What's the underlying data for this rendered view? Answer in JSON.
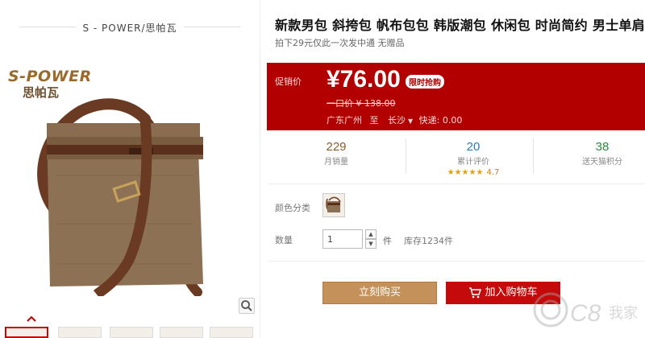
{
  "left": {
    "brand_title": "S - POWER/思帕瓦",
    "logo_en": "S-POWER",
    "logo_cn": "思帕瓦",
    "zoom_icon": "magnifier-icon",
    "thumb_up_icon": "chevron-up-icon",
    "thumbnail_count": 5
  },
  "product": {
    "title": "新款男包 斜挎包 帆布包包 韩版潮包 休闲包 时尚简约 男士单肩包",
    "subtitle": "拍下29元仅此一次发中通 无赠品"
  },
  "price": {
    "promo_label": "促销价",
    "current": "¥76.00",
    "tag": "限时抢购",
    "original": "一口价 ¥ 138.00",
    "ship_from": "广东广州",
    "ship_to_label": "至",
    "ship_to": "长沙",
    "express": "快递: 0.00"
  },
  "stats": {
    "sales_num": "229",
    "sales_label": "月销量",
    "reviews_num": "20",
    "reviews_label": "累计评价",
    "rating": "4.7",
    "stars": "★★★★★",
    "points_num": "38",
    "points_label": "送天猫积分"
  },
  "options": {
    "color_label": "颜色分类",
    "qty_label": "数量",
    "qty_value": "1",
    "qty_unit": "件",
    "stock": "库存1234件"
  },
  "actions": {
    "buy_now": "立刻购买",
    "add_cart": "加入购物车"
  },
  "colors": {
    "price_bg": "#b20000",
    "buy_btn": "#c4915a",
    "cart_btn": "#c40a0a",
    "sales": "#8b5a2b",
    "reviews": "#2a7abf",
    "points": "#2a8a3a"
  }
}
